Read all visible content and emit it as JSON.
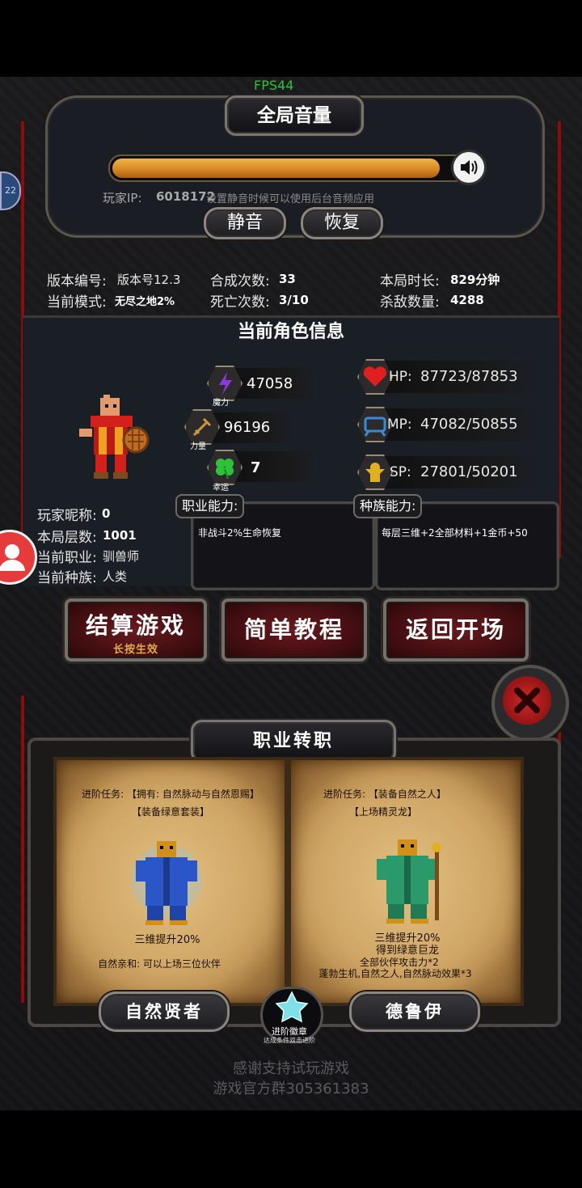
{
  "fps": "FPS44",
  "volume": {
    "title": "全局音量",
    "fill_percent": 92,
    "player_ip_label": "玩家IP:",
    "player_ip_value": "6018172",
    "mute_hint": "设置静音时候可以使用后台音频应用",
    "mute_label": "静音",
    "restore_label": "恢复",
    "side_badge": "22"
  },
  "stats": {
    "version_label": "版本编号:",
    "version_value": "版本号12.3",
    "mode_label": "当前模式:",
    "mode_value": "无尽之地2%",
    "synth_label": "合成次数:",
    "synth_value": "33",
    "death_label": "死亡次数:",
    "death_value": "3/10",
    "duration_label": "本局时长:",
    "duration_value": "829分钟",
    "kills_label": "杀敌数量:",
    "kills_value": "4288"
  },
  "character": {
    "section_title": "当前角色信息",
    "magic_value": "47058",
    "magic_label": "魔力",
    "power_value": "96196",
    "power_label": "力量",
    "luck_value": "7",
    "luck_label": "幸运",
    "hp_label": "HP:",
    "hp_value": "87723/87853",
    "mp_label": "MP:",
    "mp_value": "47082/50855",
    "sp_label": "SP:",
    "sp_value": "27801/50201",
    "nickname_label": "玩家昵称:",
    "nickname_value": "0",
    "floor_label": "本局层数:",
    "floor_value": "1001",
    "job_label": "当前职业:",
    "job_value": "驯兽师",
    "race_label": "当前种族:",
    "race_value": "人类",
    "job_ability_title": "职业能力:",
    "job_ability_text": "非战斗2%生命恢复",
    "race_ability_title": "种族能力:",
    "race_ability_text": "每层三维+2全部材料+1金币+50"
  },
  "actions": {
    "settle_label": "结算游戏",
    "settle_hint": "长按生效",
    "tutorial_label": "简单教程",
    "return_label": "返回开场"
  },
  "transfer": {
    "title": "职业转职",
    "left": {
      "task_line1": "进阶任务: 【拥有: 自然脉动与自然恩赐】",
      "task_line2": "【装备绿意套装】",
      "bonus1": "三维提升20%",
      "bonus2": "自然亲和: 可以上场三位伙伴",
      "name": "自然贤者"
    },
    "right": {
      "task_line1": "进阶任务: 【装备自然之人】",
      "task_line2": "【上场精灵龙】",
      "bonus1": "三维提升20%",
      "bonus2": "得到绿意巨龙",
      "bonus3": "全部伙伴攻击力*2",
      "bonus4": "蓬勃生机,自然之人,自然脉动效果*3",
      "name": "德鲁伊"
    },
    "badge_title": "进阶徽章",
    "badge_hint": "达成条件双击进阶"
  },
  "footer": {
    "line1": "感谢支持试玩游戏",
    "line2": "游戏官方群305361383"
  },
  "colors": {
    "hp_bar": "#e0a030",
    "accent_red": "#8a0c0c",
    "fps_green": "#2ec23a",
    "hint_gold": "#e0a94a"
  }
}
